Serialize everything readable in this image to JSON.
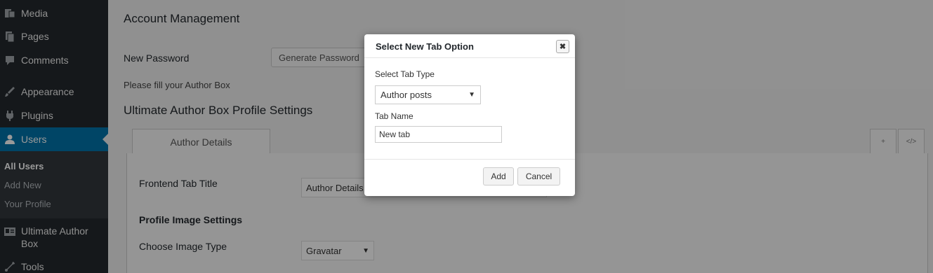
{
  "sidebar": {
    "items": [
      {
        "label": "Media",
        "icon": "media-icon"
      },
      {
        "label": "Pages",
        "icon": "pages-icon"
      },
      {
        "label": "Comments",
        "icon": "comments-icon"
      },
      {
        "label": "Appearance",
        "icon": "appearance-icon"
      },
      {
        "label": "Plugins",
        "icon": "plugins-icon"
      },
      {
        "label": "Users",
        "icon": "users-icon"
      },
      {
        "label": "Ultimate Author Box",
        "icon": "id-card-icon"
      },
      {
        "label": "Tools",
        "icon": "tools-icon"
      }
    ],
    "users_submenu": [
      "All Users",
      "Add New",
      "Your Profile"
    ],
    "colors": {
      "background": "#23282d",
      "active": "#0073aa"
    }
  },
  "main": {
    "heading": "Account Management",
    "new_password_label": "New Password",
    "generate_password_label": "Generate Password",
    "fill_author_box_text": "Please fill your Author Box",
    "profile_settings_heading": "Ultimate Author Box Profile Settings",
    "tab_author_details": "Author Details",
    "tab_add_symbol": "+",
    "tab_code_symbol": "</>",
    "frontend_tab_title_label": "Frontend Tab Title",
    "frontend_tab_title_value": "Author Details",
    "profile_image_settings_heading": "Profile Image Settings",
    "choose_image_type_label": "Choose Image Type",
    "image_type_value": "Gravatar"
  },
  "modal": {
    "title": "Select New Tab Option",
    "tab_type_label": "Select Tab Type",
    "tab_type_value": "Author posts",
    "tab_name_label": "Tab Name",
    "tab_name_value": "New tab",
    "add_label": "Add",
    "cancel_label": "Cancel",
    "close_symbol": "✖"
  }
}
